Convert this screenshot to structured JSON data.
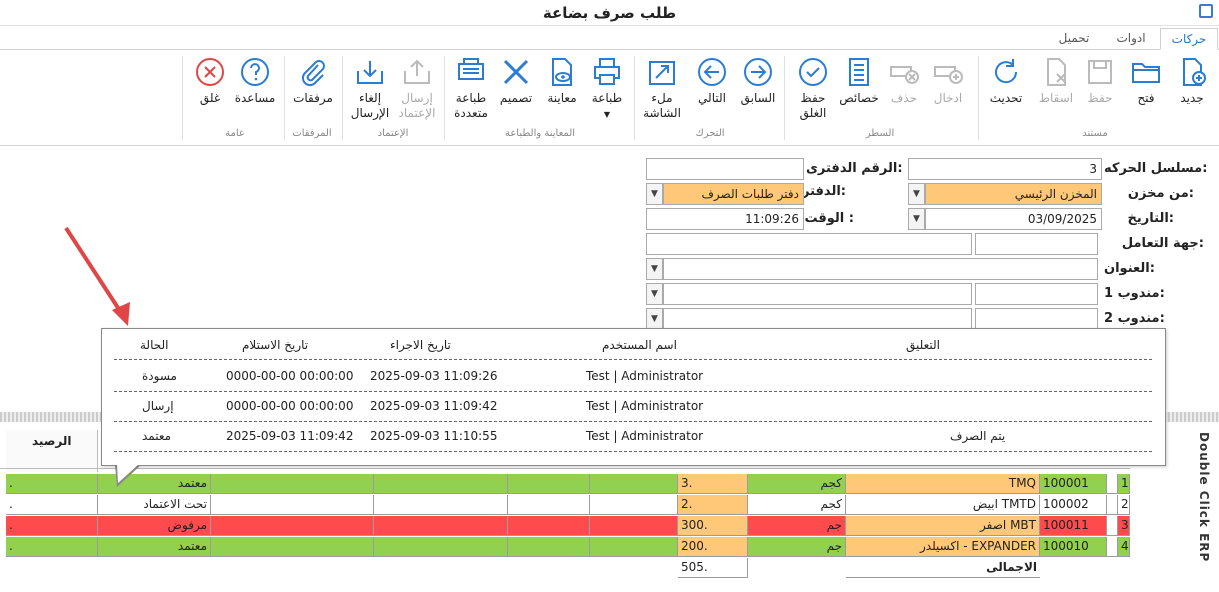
{
  "window": {
    "title": "طلب صرف بضاعة"
  },
  "tabs": [
    {
      "label": "حركات"
    },
    {
      "label": "ادوات"
    },
    {
      "label": "تحميل"
    }
  ],
  "ribbon": {
    "groups": {
      "document": "مستند",
      "line": "السطر",
      "move": "التحرك",
      "print": "المعاينة والطباعة",
      "approval": "الإعتماد",
      "attachments": "المرفقات",
      "general": "عامة"
    },
    "buttons": {
      "new": "جديد",
      "open": "فتح",
      "save": "حفظ",
      "drop": "اسقاط",
      "refresh": "تحديث",
      "insert": "ادخال",
      "delete": "حذف",
      "properties": "خصائص",
      "save_close": "حفظ الغلق",
      "prev": "السابق",
      "next": "التالي",
      "fullscreen": "ملء الشاشة",
      "print": "طباعة",
      "preview": "معاينة",
      "design": "تصميم",
      "multi_print": "طباعة متعددة",
      "send_approval": "إرسال الإعتماد",
      "cancel_send": "إلغاء الإرسال",
      "attachments": "مرفقات",
      "help": "مساعدة",
      "close": "غلق"
    }
  },
  "form": {
    "serial_label": "مسلسل الحركه:",
    "serial_value": "3",
    "ledger_label": "الرقم الدفترى:",
    "ledger_value": "",
    "store_label": "من مخزن:",
    "store_value": "المخزن الرئيسي",
    "book_label": "الدفتر:",
    "book_value": "دفتر طلبات الصرف",
    "date_label": "التاريخ:",
    "date_value": "03/09/2025",
    "time_label": "الوقت :",
    "time_value": "11:09:26",
    "party_label": "جهة التعامل:",
    "address_label": "العنوان:",
    "rep1_label": "مندوب 1:",
    "rep2_label": "مندوب 2:"
  },
  "grid": {
    "balance_header": "الرصيد",
    "rows": [
      {
        "idx": "1",
        "code": "100001",
        "name": "TMQ",
        "unit": "كجم",
        "qty": "3.",
        "status": "معتمد",
        "bal": ".",
        "color": "g"
      },
      {
        "idx": "2",
        "code": "100002",
        "name": "ابيض TMTD",
        "unit": "كجم",
        "qty": "2.",
        "status": "تحت الاعتماد",
        "bal": ".",
        "color": "w"
      },
      {
        "idx": "3",
        "code": "100011",
        "name": "اصفر MBT",
        "unit": "جم",
        "qty": "300.",
        "status": "مرفوض",
        "bal": ".",
        "color": "r"
      },
      {
        "idx": "4",
        "code": "100010",
        "name": "اكسيلدر - EXPANDER",
        "unit": "جم",
        "qty": "200.",
        "status": "معتمد",
        "bal": ".",
        "color": "g"
      }
    ],
    "total_label": "الاجمالى",
    "total_value": "505."
  },
  "side_label": "Double Click ERP",
  "popup": {
    "headers": {
      "comment": "التعليق",
      "user": "اسم المستخدم",
      "exec": "تاريخ الاجراء",
      "recv": "تاريخ الاستلام",
      "status": "الحالة"
    },
    "rows": [
      {
        "comment": "",
        "user": "Test | Administrator",
        "exec": "2025-09-03 11:09:26",
        "recv": "0000-00-00 00:00:00",
        "status": "مسودة"
      },
      {
        "comment": "",
        "user": "Test | Administrator",
        "exec": "2025-09-03 11:09:42",
        "recv": "0000-00-00 00:00:00",
        "status": "إرسال"
      },
      {
        "comment": "يتم الصرف",
        "user": "Test | Administrator",
        "exec": "2025-09-03 11:10:55",
        "recv": "2025-09-03 11:09:42",
        "status": "معتمد"
      }
    ]
  },
  "colors": {
    "accent": "#2277cc",
    "approved": "#92d050",
    "rejected": "#ff4b4b",
    "highlight": "#ffc878"
  }
}
